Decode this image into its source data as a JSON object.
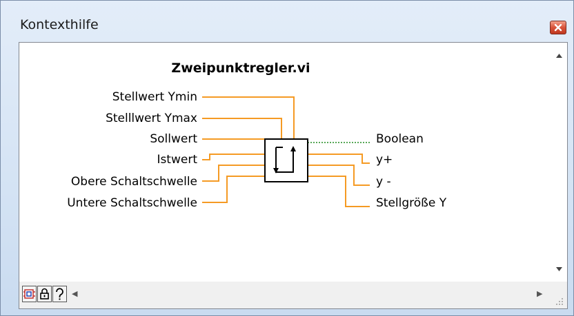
{
  "window": {
    "title": "Kontexthilfe"
  },
  "vi": {
    "name": "Zweipunktregler.vi",
    "inputs": [
      "Stellwert Ymin",
      "Stelllwert Ymax",
      "Sollwert",
      "Istwert",
      "Obere Schaltschwelle",
      "Untere Schaltschwelle"
    ],
    "outputs": [
      "Boolean",
      "y+",
      "y -",
      "Stellgröße Y"
    ]
  },
  "colors": {
    "wire_numeric": "#f59a23",
    "wire_boolean": "#1f8a1f",
    "close_button": "#d9533a"
  },
  "icons": {
    "close": "close-icon",
    "detail_toggle": "detailed-help-icon",
    "lock": "lock-icon",
    "help": "question-help-icon"
  }
}
